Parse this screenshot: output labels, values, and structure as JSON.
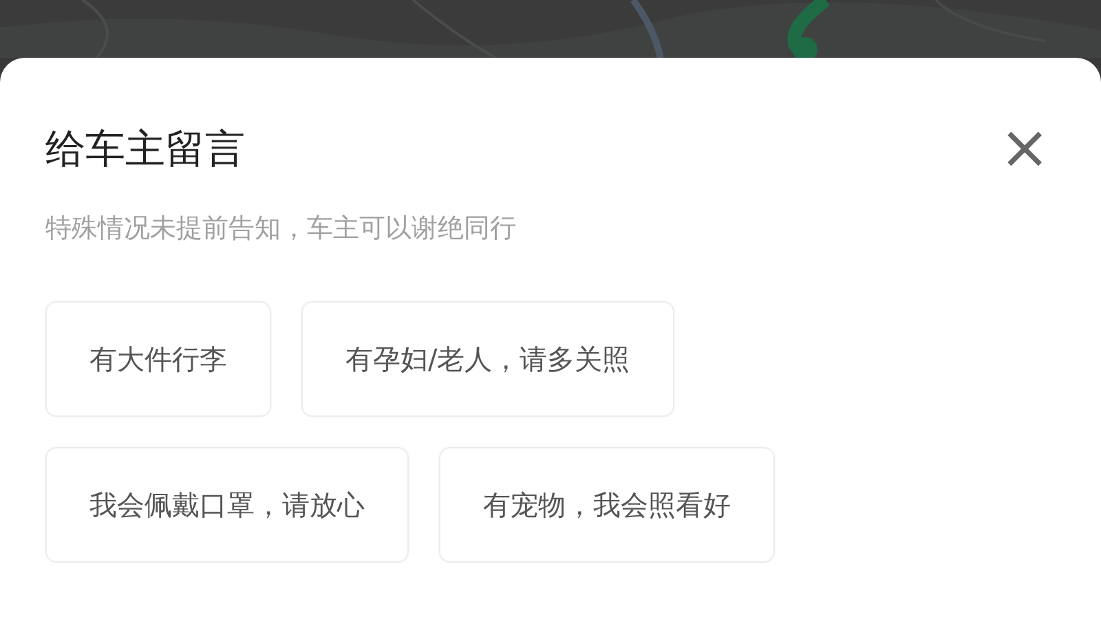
{
  "sheet": {
    "title": "给车主留言",
    "subtitle": "特殊情况未提前告知，车主可以谢绝同行",
    "close": "×",
    "options": [
      {
        "label": "有大件行李"
      },
      {
        "label": "有孕妇/老人，请多关照"
      },
      {
        "label": "我会佩戴口罩，请放心"
      },
      {
        "label": "有宠物，我会照看好"
      }
    ]
  }
}
